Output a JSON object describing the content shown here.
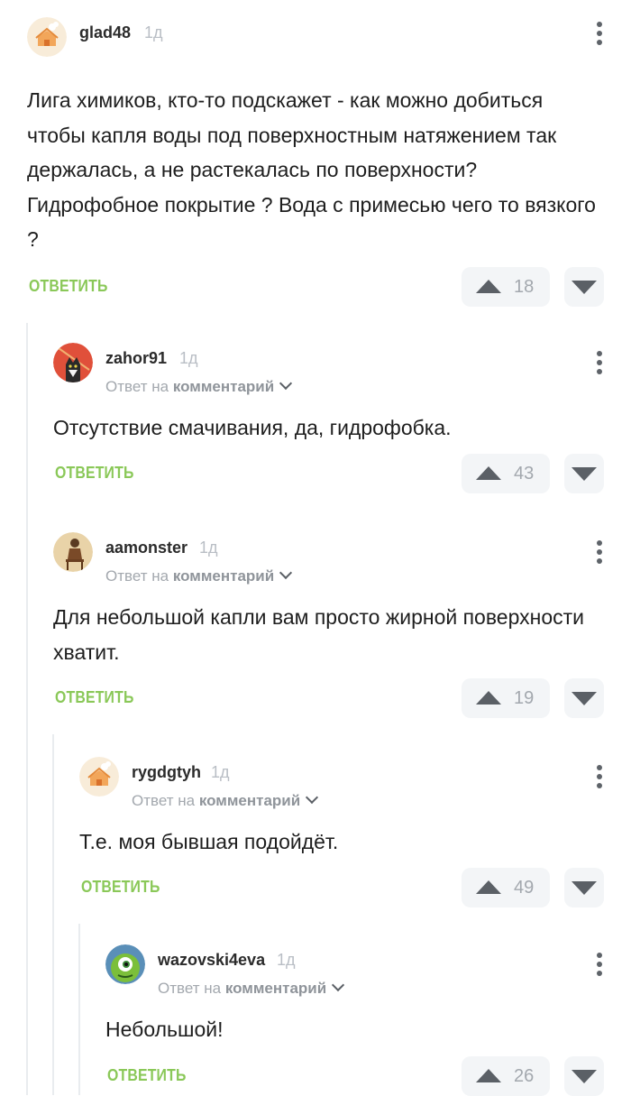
{
  "ui": {
    "reply_label": "ОТВЕТИТЬ",
    "reply_to_prefix": "Ответ на",
    "reply_to_target": "комментарий"
  },
  "comments": [
    {
      "username": "glad48",
      "time": "1д",
      "text": "Лига химиков, кто-то подскажет - как можно добиться чтобы капля воды под поверхностным натяжением так держалась, а не растекалась по поверхности? Гидрофобное покрытие ? Вода с примесью чего то вязкого ?",
      "rating": "18",
      "avatar": "pikabu-house-avatar"
    },
    {
      "username": "zahor91",
      "time": "1д",
      "text": "Отсутствие смачивания, да, гидрофобка.",
      "rating": "43",
      "avatar": "cat-avatar"
    },
    {
      "username": "aamonster",
      "time": "1д",
      "text": "Для небольшой капли вам просто жирной поверхности хватит.",
      "rating": "19",
      "avatar": "sitting-figure-avatar"
    },
    {
      "username": "rygdgtyh",
      "time": "1д",
      "text": "Т.е. моя бывшая подойдёт.",
      "rating": "49",
      "avatar": "pikabu-house-avatar"
    },
    {
      "username": "wazovski4eva",
      "time": "1д",
      "text": "Небольшой!",
      "rating": "26",
      "avatar": "mike-wazowski-avatar"
    }
  ]
}
